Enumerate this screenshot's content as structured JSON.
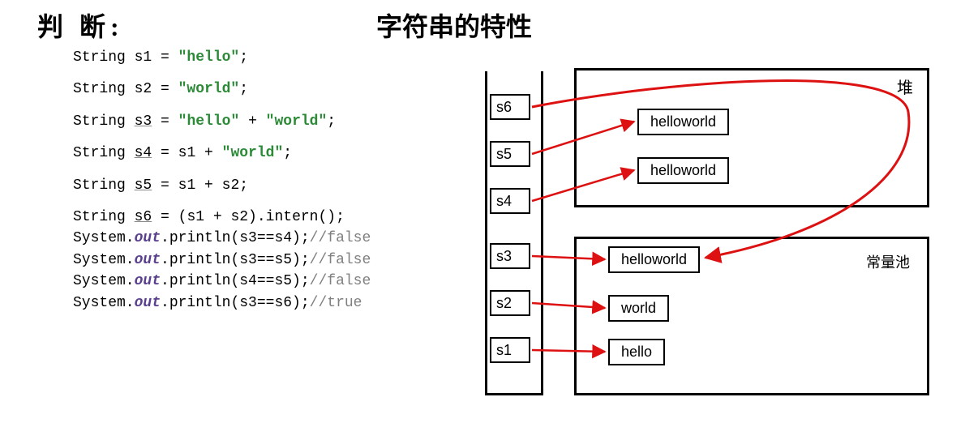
{
  "headings": {
    "left": "判 断:",
    "right": "字符串的特性"
  },
  "code": {
    "l1": {
      "decl": "String s1 = ",
      "str": "\"hello\"",
      "tail": ";"
    },
    "l2": {
      "decl": "String s2 = ",
      "str": "\"world\"",
      "tail": ";"
    },
    "l3": {
      "decl": "String ",
      "var": "s3",
      "mid": " = ",
      "strA": "\"hello\"",
      "plus": " + ",
      "strB": "\"world\"",
      "tail": ";"
    },
    "l4": {
      "decl": "String ",
      "var": "s4",
      "mid": " = s1 + ",
      "str": "\"world\"",
      "tail": ";"
    },
    "l5": {
      "decl": "String ",
      "var": "s5",
      "mid": " = s1 + s2;",
      "str": "",
      "tail": ""
    },
    "l6": {
      "decl": "String ",
      "var": "s6",
      "mid": " = (s1 + s2).intern();"
    },
    "p1": {
      "sys": "System.",
      "out": "out",
      "call": ".println(s3==s4);",
      "cmt": "//false"
    },
    "p2": {
      "sys": "System.",
      "out": "out",
      "call": ".println(s3==s5);",
      "cmt": "//false"
    },
    "p3": {
      "sys": "System.",
      "out": "out",
      "call": ".println(s4==s5);",
      "cmt": "//false"
    },
    "p4": {
      "sys": "System.",
      "out": "out",
      "call": ".println(s3==s6);",
      "cmt": "//true"
    }
  },
  "diagram": {
    "stack": [
      "s6",
      "s5",
      "s4",
      "s3",
      "s2",
      "s1"
    ],
    "heap_label": "堆",
    "pool_label": "常量池",
    "heap_objects": [
      "helloworld",
      "helloworld"
    ],
    "pool_objects": [
      "helloworld",
      "world",
      "hello"
    ]
  }
}
